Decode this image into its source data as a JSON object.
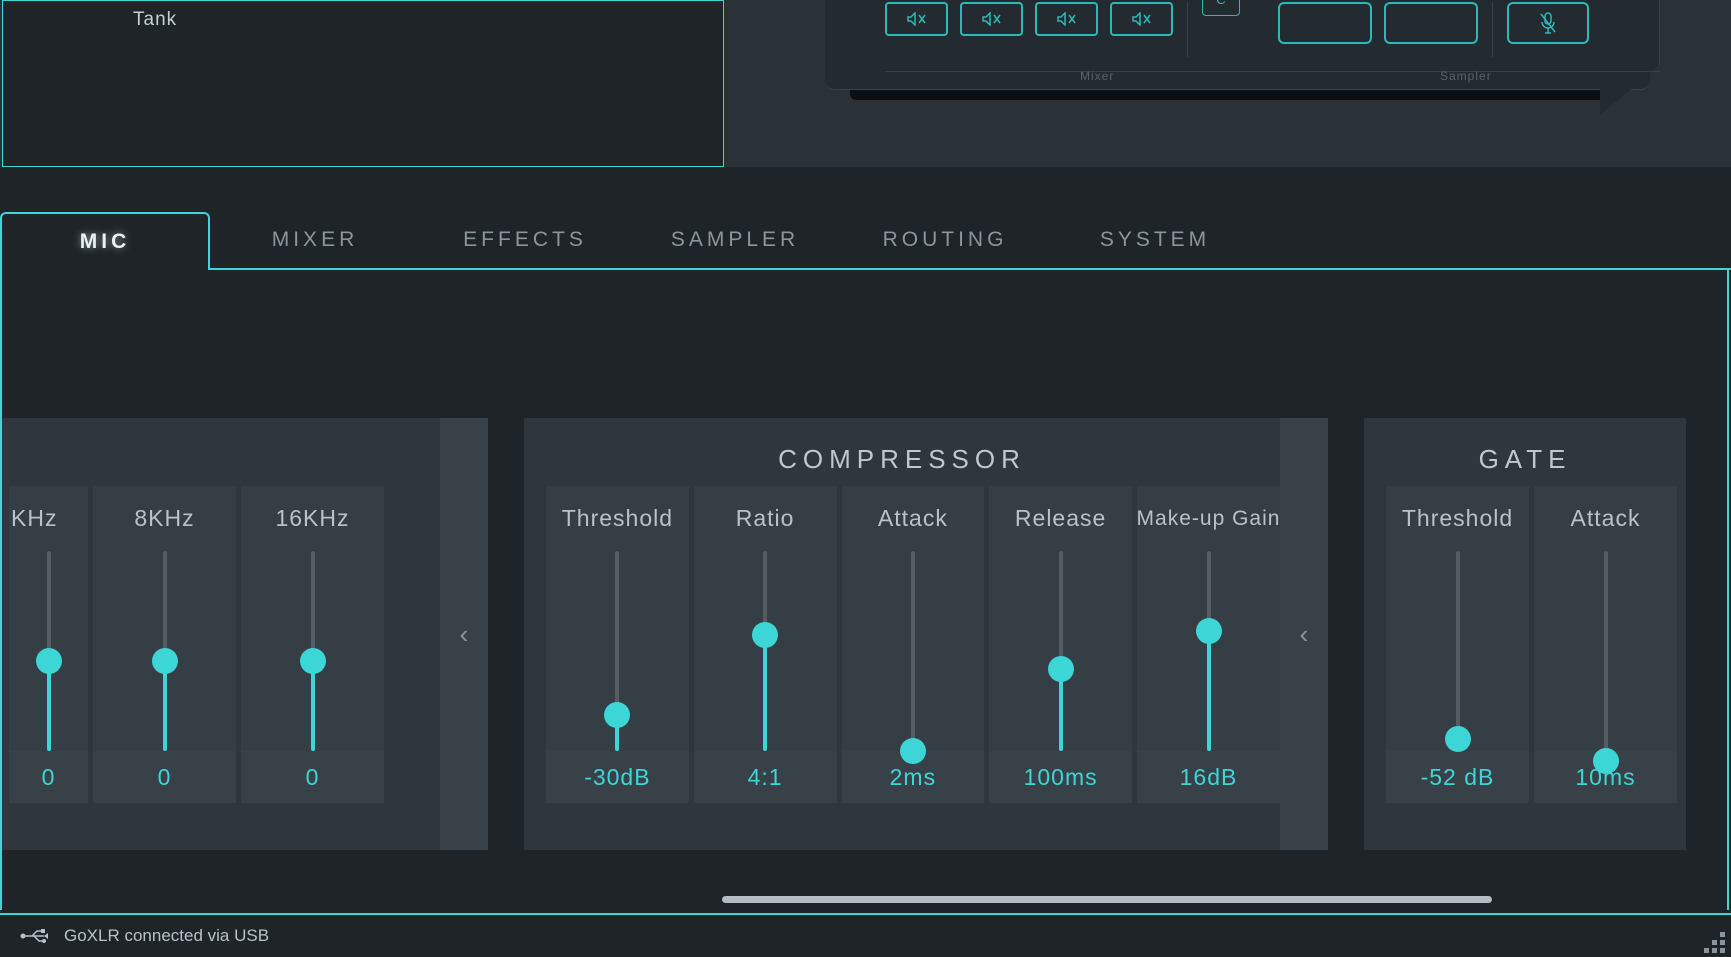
{
  "profile": {
    "name": "Tank"
  },
  "hardware": {
    "mixer_label": "Mixer",
    "sampler_label": "Sampler",
    "bank_label": "C"
  },
  "tabs": [
    {
      "label": "MIC",
      "active": true
    },
    {
      "label": "MIXER",
      "active": false
    },
    {
      "label": "EFFECTS",
      "active": false
    },
    {
      "label": "SAMPLER",
      "active": false
    },
    {
      "label": "ROUTING",
      "active": false
    },
    {
      "label": "SYSTEM",
      "active": false
    }
  ],
  "eq": {
    "sliders": [
      {
        "label": "KHz",
        "value": "0",
        "pct": 45
      },
      {
        "label": "8KHz",
        "value": "0",
        "pct": 45
      },
      {
        "label": "16KHz",
        "value": "0",
        "pct": 45
      }
    ]
  },
  "compressor": {
    "title": "COMPRESSOR",
    "sliders": [
      {
        "label": "Threshold",
        "value": "-30dB",
        "pct": 18
      },
      {
        "label": "Ratio",
        "value": "4:1",
        "pct": 58
      },
      {
        "label": "Attack",
        "value": "2ms",
        "pct": 0
      },
      {
        "label": "Release",
        "value": "100ms",
        "pct": 41
      },
      {
        "label": "Make-up Gain",
        "value": "16dB",
        "pct": 60
      }
    ]
  },
  "gate": {
    "title": "GATE",
    "sliders": [
      {
        "label": "Threshold",
        "value": "-52 dB",
        "pct": 6
      },
      {
        "label": "Attack",
        "value": "10ms",
        "pct": -5
      }
    ]
  },
  "status": {
    "text": "GoXLR connected via USB"
  }
}
